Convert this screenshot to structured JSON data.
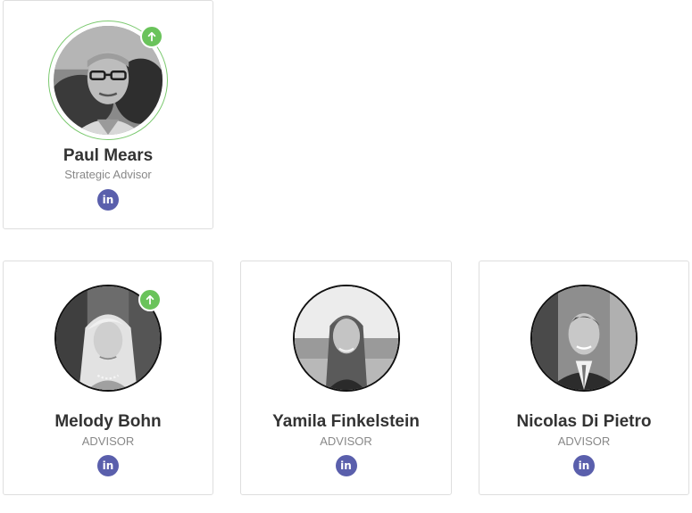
{
  "members": [
    {
      "name": "Paul Mears",
      "role": "Strategic Advisor",
      "featured": true,
      "linkedin_label": "in"
    },
    {
      "name": "Melody Bohn",
      "role": "ADVISOR",
      "featured": true,
      "linkedin_label": "in"
    },
    {
      "name": "Yamila Finkelstein",
      "role": "ADVISOR",
      "featured": false,
      "linkedin_label": "in"
    },
    {
      "name": "Nicolas Di Pietro",
      "role": "ADVISOR",
      "featured": false,
      "linkedin_label": "in"
    }
  ],
  "icons": {
    "badge": "arrow-up-icon",
    "social": "linkedin-icon"
  },
  "colors": {
    "badge_green": "#6ac35b",
    "ring_green": "#7bc96f",
    "linkedin_purple": "#5a5fac",
    "name_text": "#333333",
    "role_text": "#888888",
    "card_border": "#dedede"
  }
}
